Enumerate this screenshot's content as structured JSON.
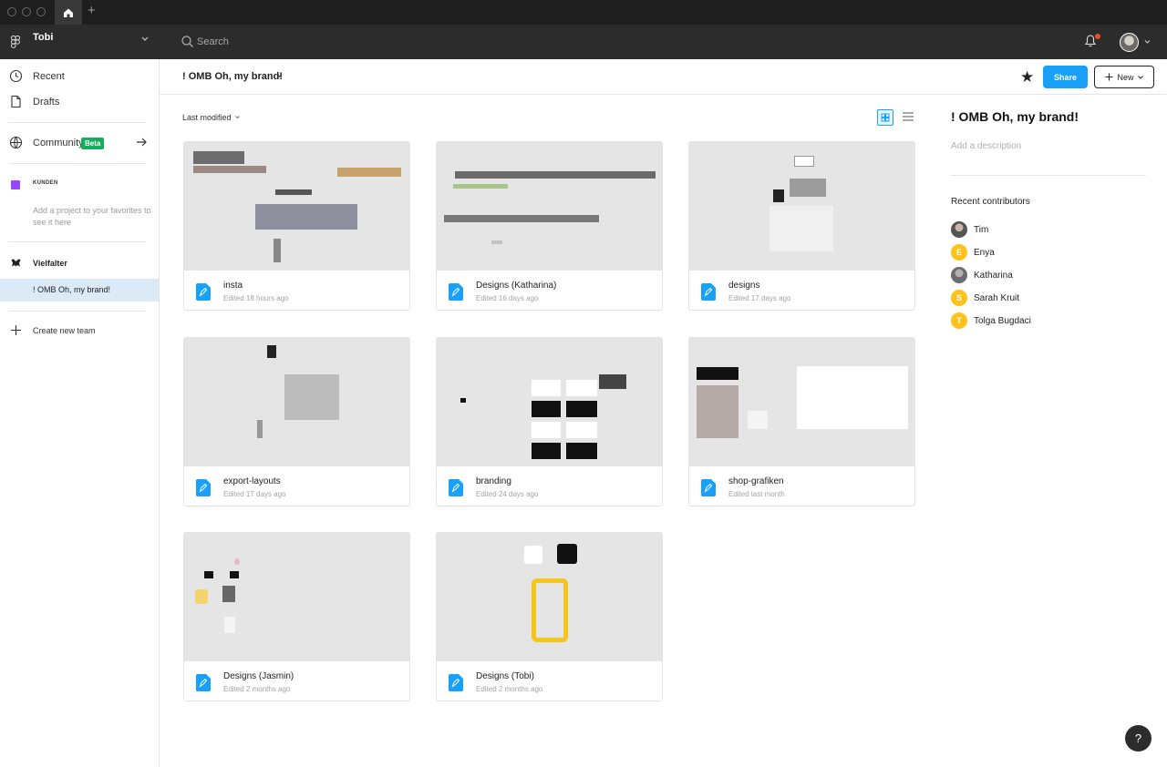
{
  "titlebar": {
    "home_icon": "home-icon",
    "new_tab_label": "+"
  },
  "topbar": {
    "team_name": "Tobi",
    "search_placeholder": "Search",
    "notification_dot_color": "#f24e1e"
  },
  "sidebar": {
    "recent": "Recent",
    "drafts": "Drafts",
    "community": "Community",
    "community_badge": "Beta",
    "favorites_project": "KUNDEN",
    "favorites_hint": "Add a project to your favorites to see it here",
    "team": "Vielfalter",
    "active_project": "! OMB Oh, my brand!",
    "create_team": "Create new team"
  },
  "header": {
    "project_title": "! OMB Oh, my brand!",
    "share_label": "Share",
    "new_label": "New"
  },
  "files": {
    "sort_label": "Last modified",
    "items": [
      {
        "name": "insta",
        "meta": "Edited 18 hours ago"
      },
      {
        "name": "Designs (Katharina)",
        "meta": "Edited 16 days ago"
      },
      {
        "name": "designs",
        "meta": "Edited 17 days ago"
      },
      {
        "name": "export-layouts",
        "meta": "Edited 17 days ago"
      },
      {
        "name": "branding",
        "meta": "Edited 24 days ago"
      },
      {
        "name": "shop-grafiken",
        "meta": "Edited last month"
      },
      {
        "name": "Designs (Jasmin)",
        "meta": "Edited 2 months ago"
      },
      {
        "name": "Designs (Tobi)",
        "meta": "Edited 2 months ago"
      }
    ]
  },
  "details": {
    "title": "! OMB Oh, my brand!",
    "description_placeholder": "Add a description",
    "contributors_heading": "Recent contributors",
    "contributors": [
      {
        "name": "Tim",
        "initial": "",
        "color": "#6b6b6b"
      },
      {
        "name": "Enya",
        "initial": "E",
        "color": "#ffc21a"
      },
      {
        "name": "Katharina",
        "initial": "",
        "color": "#8a8a8a"
      },
      {
        "name": "Sarah Kruit",
        "initial": "S",
        "color": "#ffc21a"
      },
      {
        "name": "Tolga Bugdaci",
        "initial": "T",
        "color": "#ffc21a"
      }
    ]
  },
  "help_label": "?",
  "colors": {
    "accent": "#18a0fb",
    "selected_bg": "#daebf7",
    "beta_green": "#14ae5c"
  }
}
